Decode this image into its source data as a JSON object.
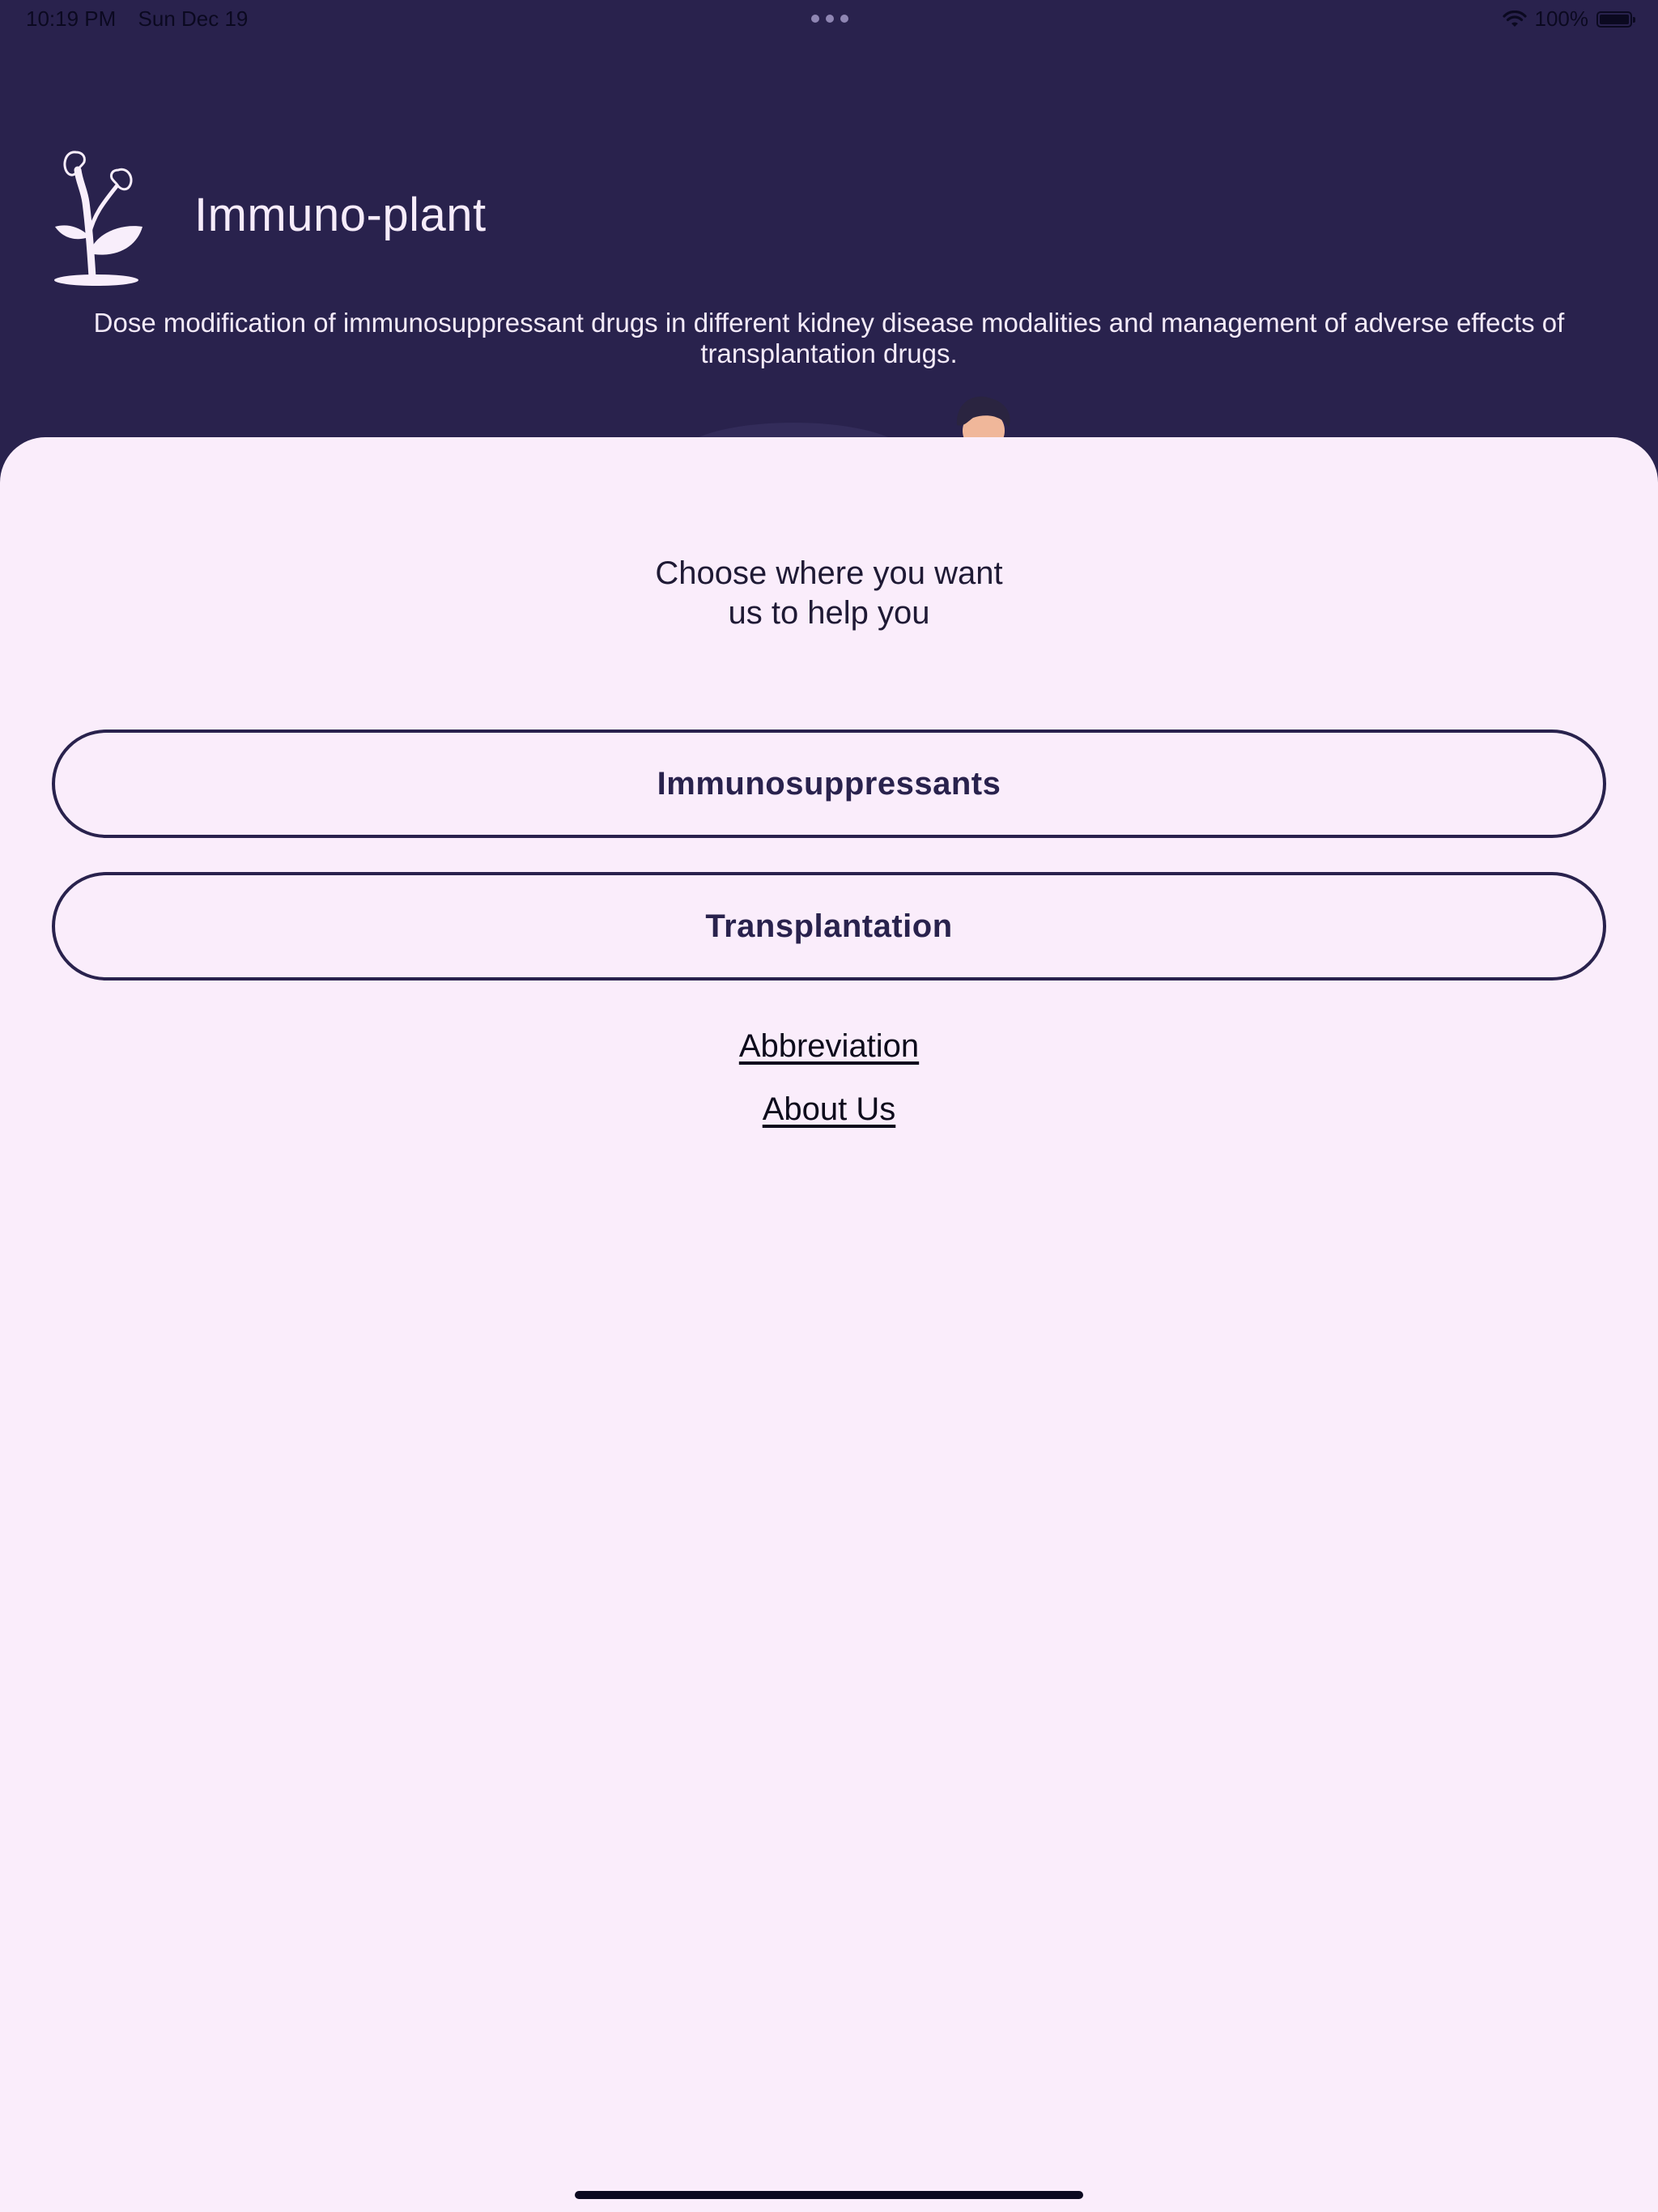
{
  "status_bar": {
    "time": "10:19 PM",
    "date": "Sun Dec 19",
    "battery": "100%",
    "battery_level": 1.0
  },
  "header": {
    "app_title": "Immuno-plant",
    "tagline": "Dose modification of immunosuppressant drugs in different kidney disease modalities and management of adverse effects of transplantation drugs.",
    "logo_icon": "plant-kidney-icon"
  },
  "main": {
    "prompt_line1": "Choose where you want",
    "prompt_line2": "us to help you",
    "buttons": [
      {
        "label": "Immunosuppressants"
      },
      {
        "label": "Transplantation"
      }
    ],
    "links": [
      {
        "label": "Abbreviation"
      },
      {
        "label": "About Us"
      }
    ]
  },
  "colors": {
    "header_bg": "#29224d",
    "sheet_bg": "#faedfb",
    "accent": "#29224d"
  }
}
